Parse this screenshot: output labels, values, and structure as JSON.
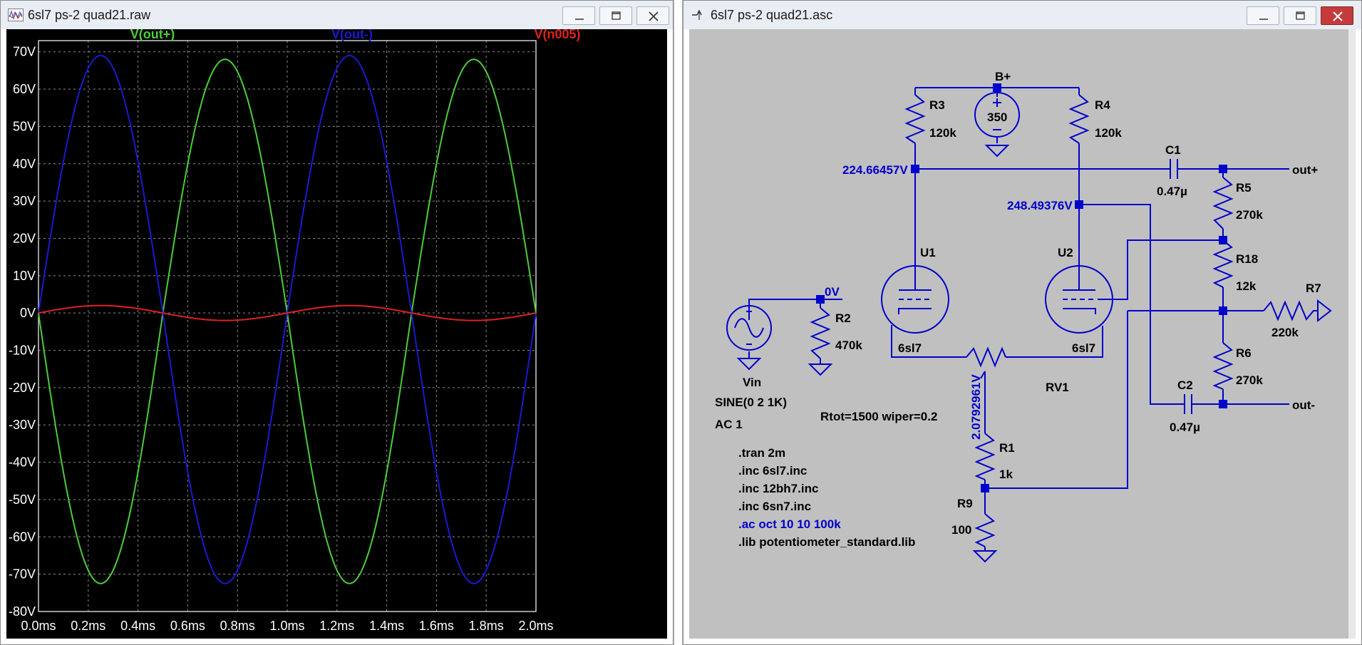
{
  "left_window": {
    "title": "6sl7 ps-2 quad21.raw",
    "traces": [
      {
        "name": "V(out+)",
        "color": "#4ccc3c"
      },
      {
        "name": "V(out-)",
        "color": "#1a1ad0"
      },
      {
        "name": "V(n005)",
        "color": "#e02020"
      }
    ]
  },
  "right_window": {
    "title": "6sl7 ps-2 quad21.asc",
    "labels": {
      "bplus": "B+",
      "supply_value": "350",
      "r3": "R3",
      "r3_val": "120k",
      "r4": "R4",
      "r4_val": "120k",
      "c1": "C1",
      "c1_val": "0.47µ",
      "c2": "C2",
      "c2_val": "0.47µ",
      "r5": "R5",
      "r5_val": "270k",
      "r18": "R18",
      "r18_val": "12k",
      "r6": "R6",
      "r6_val": "270k",
      "r7": "R7",
      "r7_val": "220k",
      "r2": "R2",
      "r2_val": "470k",
      "r1": "R1",
      "r1_val": "1k",
      "r9": "R9",
      "r9_val": "100",
      "rv1": "RV1",
      "rv1_params": "Rtot=1500 wiper=0.2",
      "u1": "U1",
      "u1_model": "6sl7",
      "u2": "U2",
      "u2_model": "6sl7",
      "out_plus": "out+",
      "out_minus": "out-",
      "v_node1": "224.66457V",
      "v_node2": "248.49376V",
      "v_node3": "2.0792961V",
      "v_zero": "0V",
      "vin": "Vin",
      "vin_sine": "SINE(0 2 1K)",
      "vin_ac": "AC 1"
    },
    "directives": [
      {
        "text": ".tran 2m",
        "color": "#000000"
      },
      {
        "text": ".inc 6sl7.inc",
        "color": "#000000"
      },
      {
        "text": ".inc 12bh7.inc",
        "color": "#000000"
      },
      {
        "text": ".inc 6sn7.inc",
        "color": "#000000"
      },
      {
        "text": ".ac oct 10 10 100k",
        "color": "#0000cc"
      },
      {
        "text": ".lib potentiometer_standard.lib",
        "color": "#000000"
      }
    ]
  },
  "chart_data": {
    "type": "line",
    "title": "",
    "xlabel": "",
    "ylabel": "",
    "x_ticks": [
      "0.0ms",
      "0.2ms",
      "0.4ms",
      "0.6ms",
      "0.8ms",
      "1.0ms",
      "1.2ms",
      "1.4ms",
      "1.6ms",
      "1.8ms",
      "2.0ms"
    ],
    "y_ticks": [
      "70V",
      "60V",
      "50V",
      "40V",
      "30V",
      "20V",
      "10V",
      "0V",
      "-10V",
      "-20V",
      "-30V",
      "-40V",
      "-50V",
      "-60V",
      "-70V",
      "-80V"
    ],
    "xlim": [
      0,
      2.0
    ],
    "ylim": [
      -80,
      73
    ],
    "grid": true,
    "series": [
      {
        "name": "V(out+)",
        "color": "#4ccc3c",
        "frequency_khz": 1,
        "amplitude_positive": 68,
        "amplitude_negative": 72.5,
        "phase": "inverted",
        "x": [
          0,
          0.25,
          0.5,
          0.75,
          1.0,
          1.25,
          1.5,
          1.75,
          2.0
        ],
        "y": [
          0,
          -72.5,
          0,
          68,
          0,
          -72.5,
          0,
          68,
          0
        ]
      },
      {
        "name": "V(out-)",
        "color": "#1a1ad0",
        "frequency_khz": 1,
        "amplitude_positive": 69,
        "amplitude_negative": 72.5,
        "phase": "normal",
        "x": [
          0,
          0.25,
          0.5,
          0.75,
          1.0,
          1.25,
          1.5,
          1.75,
          2.0
        ],
        "y": [
          0,
          69,
          0,
          -72.5,
          0,
          69,
          0,
          -72.5,
          0
        ]
      },
      {
        "name": "V(n005)",
        "color": "#e02020",
        "frequency_khz": 1,
        "amplitude_positive": 2,
        "amplitude_negative": 2,
        "phase": "normal",
        "x": [
          0,
          0.25,
          0.5,
          0.75,
          1.0,
          1.25,
          1.5,
          1.75,
          2.0
        ],
        "y": [
          0,
          2,
          0,
          -2,
          0,
          2,
          0,
          -2,
          0
        ]
      }
    ]
  }
}
